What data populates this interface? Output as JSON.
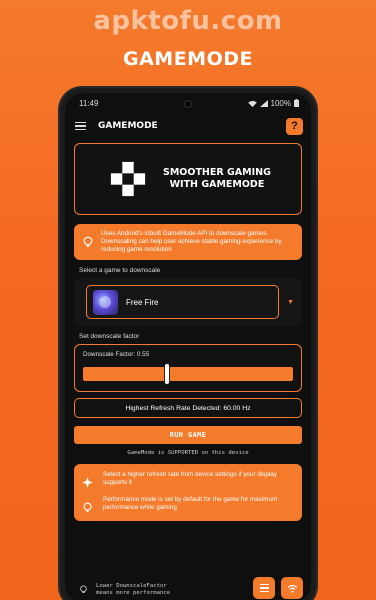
{
  "promo": {
    "watermark": "apktofu.com",
    "title": "GAMEMODE"
  },
  "statusbar": {
    "time": "11:49",
    "battery": "100%"
  },
  "appbar": {
    "title": "GAMEMODE",
    "help_label": "?"
  },
  "banner": {
    "line1": "SMOOTHER GAMING",
    "line2": "WITH GAMEMODE"
  },
  "info": {
    "text": "Uses Android's inbuilt GameMode API to downscale games. Downscaling can help user achieve stable gaming experience by reducing game resolution"
  },
  "game_select": {
    "label": "Select a game to downscale",
    "selected": "Free Fire"
  },
  "downscale": {
    "label": "Set downscale factor",
    "factor_text": "Downscale Factor: 0.55",
    "value": 0.55,
    "slider_fraction": 0.4
  },
  "refresh": {
    "text": "Highest Refresh Rate Detected: 60.00 Hz"
  },
  "run_button": {
    "label": "RUN GAME"
  },
  "support": {
    "text": "GameMode is SUPPORTED on this device"
  },
  "tips": [
    {
      "text": "Select a higher refresh rate from device settings if your display supports it"
    },
    {
      "text": "Performance mode is set by default for the game for maximum performance while gaming"
    }
  ],
  "legend": {
    "line1": "Lower DownscaleFactor",
    "line2": "means more performance"
  },
  "colors": {
    "accent": "#f47b2c",
    "background": "#0f0f0f"
  }
}
